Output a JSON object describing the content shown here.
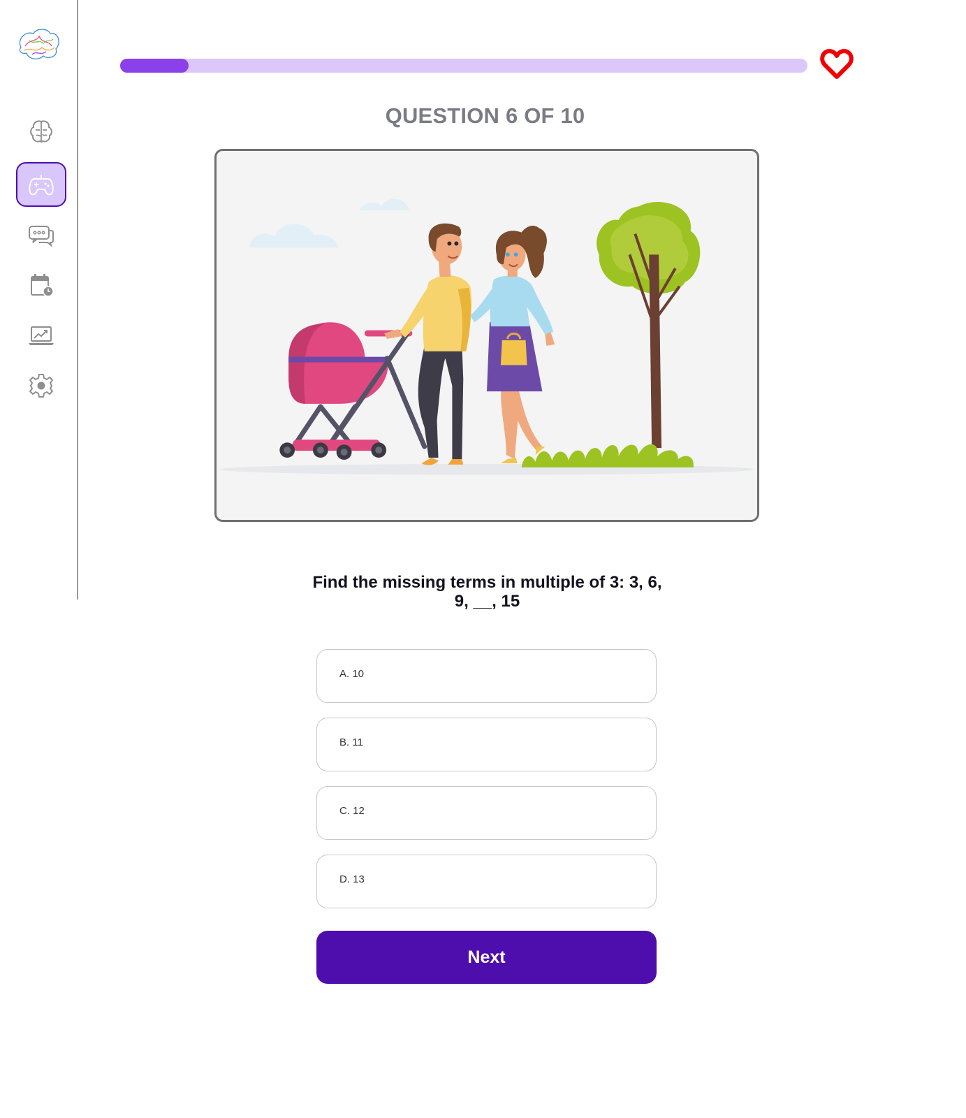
{
  "sidebar": {
    "logo": "brain-logo",
    "items": [
      {
        "icon": "brain-icon",
        "active": false
      },
      {
        "icon": "gamepad-icon",
        "active": true
      },
      {
        "icon": "chat-icon",
        "active": false
      },
      {
        "icon": "calendar-clock-icon",
        "active": false
      },
      {
        "icon": "analytics-laptop-icon",
        "active": false
      },
      {
        "icon": "gear-icon",
        "active": false
      }
    ]
  },
  "progress": {
    "fraction": 0.1,
    "fill_color": "#8b41ea",
    "track_color": "#dcc7fb"
  },
  "lives": {
    "icon": "heart-icon",
    "color": "#f20000"
  },
  "quiz": {
    "counter": "QUESTION 6 OF 10",
    "illustration": "family-stroller-illustration",
    "question": "Find the missing terms in multiple of 3: 3, 6, 9, __, 15",
    "options": [
      {
        "label": "A. 10"
      },
      {
        "label": "B. 11"
      },
      {
        "label": "C. 12"
      },
      {
        "label": "D. 13"
      }
    ],
    "next_label": "Next"
  },
  "colors": {
    "accent": "#4e0ead",
    "active_nav_bg": "#d9c6fb"
  }
}
